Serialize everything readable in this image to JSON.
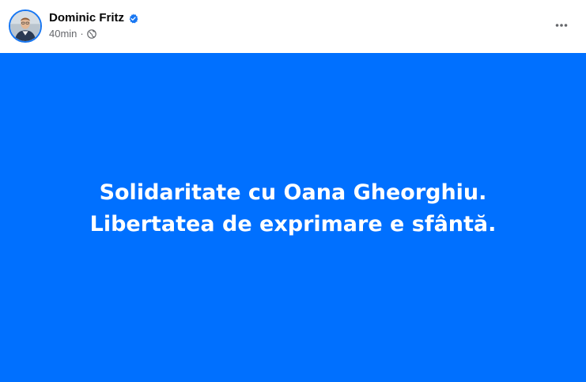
{
  "post": {
    "author": {
      "name": "Dominic Fritz",
      "verified": true,
      "avatar_icon": "profile-photo"
    },
    "meta": {
      "time": "40min",
      "separator": "·",
      "audience_icon": "globe-icon"
    },
    "more_icon": "more-horizontal-icon",
    "background_color": "#0070ff",
    "text_color": "#ffffff",
    "text_lines": [
      "Solidaritate cu Oana Gheorghiu.",
      "Libertatea de exprimare e sfântă."
    ]
  },
  "colors": {
    "verified_badge": "#1877f2",
    "meta_text": "#65676b",
    "author_text": "#050505"
  }
}
